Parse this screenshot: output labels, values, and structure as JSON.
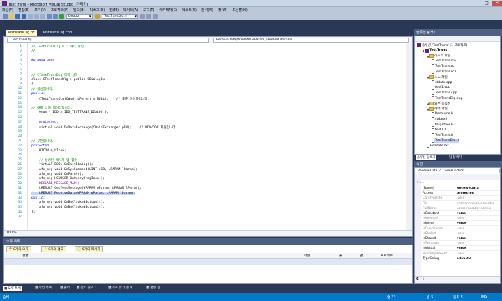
{
  "window": {
    "title": "TestTrans - Microsoft Visual Studio (관리자)",
    "controls": [
      "–",
      "□",
      "✕"
    ]
  },
  "menu": [
    "파일(F)",
    "편집(E)",
    "보기(V)",
    "프로젝트(P)",
    "빌드(B)",
    "디버그(D)",
    "팀(M)",
    "데이터(A)",
    "도구(T)",
    "아키텍처(C)",
    "테스트(S)",
    "분석(N)",
    "창(W)",
    "도움말(H)"
  ],
  "toolbar": {
    "config": "Debug",
    "file_combo": "TestTransDlg.h"
  },
  "doc_tabs": [
    {
      "label": "TestTransDlg.h*",
      "active": true
    },
    {
      "label": "TestTransDlg.cpp",
      "active": false
    }
  ],
  "nav": {
    "left": "CTestTransDlg",
    "right": "ReceiveData(WPARAM wParam, LPARAM lParam)"
  },
  "code_lines": [
    {
      "n": "1",
      "t": "// TestTransDlg.h : 헤더 파일",
      "c": "cm"
    },
    {
      "n": "2",
      "t": "//",
      "c": "cm"
    },
    {
      "n": "3",
      "t": "",
      "c": ""
    },
    {
      "n": "4",
      "t": "#pragma once",
      "c": "kw"
    },
    {
      "n": "5",
      "t": "",
      "c": ""
    },
    {
      "n": "6",
      "t": "",
      "c": ""
    },
    {
      "n": "7",
      "t": "// CTestTransDlg 대화 상자",
      "c": "cm"
    },
    {
      "n": "8",
      "t": "class CTestTransDlg : public CDialogEx",
      "c": "mix1"
    },
    {
      "n": "9",
      "t": "{",
      "c": ""
    },
    {
      "n": "10",
      "t": "// 생성입니다.",
      "c": "cm"
    },
    {
      "n": "11",
      "t": "public:",
      "c": "kw"
    },
    {
      "n": "12",
      "t": "    CTestTransDlg(CWnd* pParent = NULL);    // 표준 생성자입니다.",
      "c": "mix2"
    },
    {
      "n": "13",
      "t": "",
      "c": ""
    },
    {
      "n": "14",
      "t": "// 대화 상자 데이터입니다.",
      "c": "cm"
    },
    {
      "n": "15",
      "t": "    enum { IDD = IDD_TESTTRANS_DIALOG };",
      "c": "mix3"
    },
    {
      "n": "16",
      "t": "",
      "c": ""
    },
    {
      "n": "17",
      "t": "    protected:",
      "c": "kw"
    },
    {
      "n": "18",
      "t": "    virtual void DoDataExchange(CDataExchange* pDX);    // DDX/DDV 지원입니다.",
      "c": "mix4"
    },
    {
      "n": "19",
      "t": "",
      "c": ""
    },
    {
      "n": "20",
      "t": "",
      "c": ""
    },
    {
      "n": "21",
      "t": "// 구현입니다.",
      "c": "cm"
    },
    {
      "n": "22",
      "t": "protected:",
      "c": "kw"
    },
    {
      "n": "23",
      "t": "    HICON m_hIcon;",
      "c": "mix5"
    },
    {
      "n": "24",
      "t": "",
      "c": ""
    },
    {
      "n": "25",
      "t": "    // 생성된 메시지 맵 함수",
      "c": "cm"
    },
    {
      "n": "26",
      "t": "    virtual BOOL OnInitDialog();",
      "c": "mix6"
    },
    {
      "n": "27",
      "t": "    afx_msg void OnSysCommand(UINT nID, LPARAM lParam);",
      "c": "mix7"
    },
    {
      "n": "28",
      "t": "    afx_msg void OnPaint();",
      "c": "mix7"
    },
    {
      "n": "29",
      "t": "    afx_msg HCURSOR OnQueryDragIcon();",
      "c": "mix7"
    },
    {
      "n": "30",
      "t": "    DECLARE_MESSAGE_MAP()",
      "c": "mc"
    },
    {
      "n": "31",
      "t": "    LRESULT GetTestMessage(WPARAM wParam, LPARAM lParam);",
      "c": ""
    },
    {
      "n": "32",
      "t": "    LRESULT ReceiveData(WPARAM wParam, LPARAM lParam);",
      "c": "sel"
    },
    {
      "n": "33",
      "t": "public:",
      "c": "kw"
    },
    {
      "n": "34",
      "t": "    afx_msg void OnBnClickedButton1();",
      "c": "mix7"
    },
    {
      "n": "35",
      "t": "    afx_msg void OnBnClickedButton2();",
      "c": "mix7"
    },
    {
      "n": "36",
      "t": "};",
      "c": ""
    },
    {
      "n": "37",
      "t": "",
      "c": ""
    }
  ],
  "zoom": "100 %",
  "error_list": {
    "title": "오류 목록",
    "errors": "0개의 오류",
    "warnings": "0개의 경고",
    "messages": "0개의 메시지",
    "columns": [
      "설명",
      "파일",
      "줄",
      "열",
      "프로젝트"
    ]
  },
  "bottom_tabs": [
    "오류 목록",
    "작업 목록",
    "출력",
    "찾기 결과 1",
    "기호 찾기 결과",
    "명령 창"
  ],
  "status": {
    "ready": "준비",
    "line": "줄 33",
    "col": "열 5",
    "ch": "문자 5",
    "mode": "INS"
  },
  "solution_explorer": {
    "title": "솔루션 탐색기",
    "nodes": [
      {
        "label": "솔루션 'TestTrans' (1 프로젝트)",
        "lvl": 0,
        "kind": "sln"
      },
      {
        "label": "TestTrans",
        "lvl": 1,
        "kind": "proj",
        "bold": true
      },
      {
        "label": "리소스 파일",
        "lvl": 2,
        "kind": "fold"
      },
      {
        "label": "TestTrans.ico",
        "lvl": 3,
        "kind": "file"
      },
      {
        "label": "TestTrans.rc",
        "lvl": 3,
        "kind": "file"
      },
      {
        "label": "TestTrans.rc2",
        "lvl": 3,
        "kind": "file"
      },
      {
        "label": "소스 파일",
        "lvl": 2,
        "kind": "fold"
      },
      {
        "label": "stdafx.cpp",
        "lvl": 3,
        "kind": "file"
      },
      {
        "label": "test1.cpp",
        "lvl": 3,
        "kind": "file"
      },
      {
        "label": "TestTrans.cpp",
        "lvl": 3,
        "kind": "file"
      },
      {
        "label": "TestTransDlg.cpp",
        "lvl": 3,
        "kind": "file"
      },
      {
        "label": "외부 종속성",
        "lvl": 2,
        "kind": "fold"
      },
      {
        "label": "헤더 파일",
        "lvl": 2,
        "kind": "fold"
      },
      {
        "label": "Resource.h",
        "lvl": 3,
        "kind": "file"
      },
      {
        "label": "stdafx.h",
        "lvl": 3,
        "kind": "file"
      },
      {
        "label": "targetver.h",
        "lvl": 3,
        "kind": "file"
      },
      {
        "label": "test1.h",
        "lvl": 3,
        "kind": "file"
      },
      {
        "label": "TestTrans.h",
        "lvl": 3,
        "kind": "file"
      },
      {
        "label": "TestTransDlg.h",
        "lvl": 3,
        "kind": "file",
        "selected": true
      },
      {
        "label": "ReadMe.txt",
        "lvl": 2,
        "kind": "file"
      }
    ],
    "tabs": [
      "솔루션 탐색기",
      "팀 탐색기"
    ]
  },
  "properties": {
    "title": "속성",
    "object": "ReceiveData VCCodeFunction",
    "category": "C++",
    "rows": [
      {
        "name": "(Name)",
        "value": "ReceiveData",
        "style": "bold"
      },
      {
        "name": "Access",
        "value": "protected",
        "style": "bold"
      },
      {
        "name": "CanOverride",
        "value": "False",
        "style": "gray"
      },
      {
        "name": "File",
        "value": "c:\\Users\\tw\\documents\\",
        "style": "gray"
      },
      {
        "name": "FullName",
        "value": "CTestTransDlg::Receiv",
        "style": "gray"
      },
      {
        "name": "IsConstant",
        "value": "False",
        "style": "bold"
      },
      {
        "name": "IsInjected",
        "value": "False",
        "style": "gray"
      },
      {
        "name": "IsInline",
        "value": "False",
        "style": "bold"
      },
      {
        "name": "IsOverloaded",
        "value": "False",
        "style": "gray"
      },
      {
        "name": "IsSealed",
        "value": "False",
        "style": "gray"
      },
      {
        "name": "IsShared",
        "value": "False",
        "style": "bold"
      },
      {
        "name": "IsTemplate",
        "value": "False",
        "style": "gray"
      },
      {
        "name": "IsVirtual",
        "value": "False",
        "style": "bold"
      },
      {
        "name": "MustImplement",
        "value": "False",
        "style": "gray"
      },
      {
        "name": "TypeString",
        "value": "LRESULT",
        "style": "bold"
      }
    ],
    "desc": "C++"
  }
}
